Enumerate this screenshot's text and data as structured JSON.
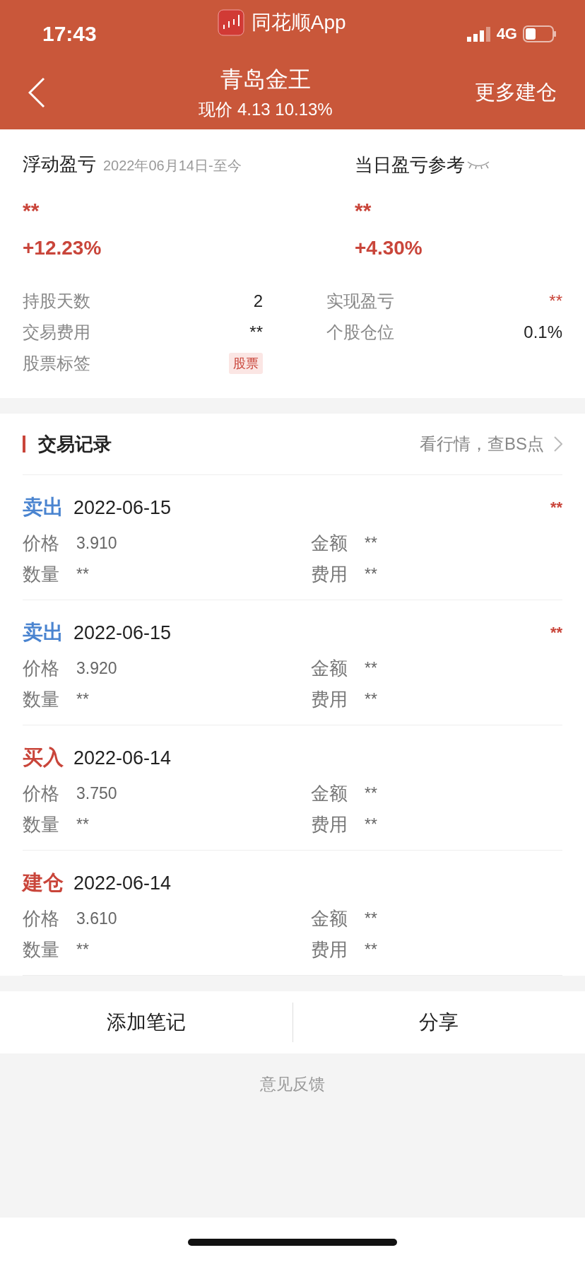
{
  "status_bar": {
    "time": "17:43",
    "app": "同花顺App",
    "network": "4G"
  },
  "nav": {
    "title": "青岛金王",
    "subtitle": "现价 4.13 10.13%",
    "action": "更多建仓"
  },
  "summary": {
    "floating": {
      "label": "浮动盈亏",
      "period": "2022年06月14日-至今",
      "value": "**",
      "percent": "+12.23%"
    },
    "daily": {
      "label": "当日盈亏参考",
      "value": "**",
      "percent": "+4.30%"
    },
    "stats": [
      {
        "label": "持股天数",
        "value": "2",
        "kind": "plain"
      },
      {
        "label": "实现盈亏",
        "value": "**",
        "kind": "profit"
      },
      {
        "label": "交易费用",
        "value": "**",
        "kind": "plain"
      },
      {
        "label": "个股仓位",
        "value": "0.1%",
        "kind": "plain"
      },
      {
        "label": "股票标签",
        "value": "股票",
        "kind": "tag"
      }
    ]
  },
  "trades": {
    "title": "交易记录",
    "link": "看行情，查BS点",
    "records": [
      {
        "type": "卖出",
        "kind": "sell",
        "date": "2022-06-15",
        "result": "**",
        "fields": [
          {
            "label": "价格",
            "value": "3.910"
          },
          {
            "label": "金额",
            "value": "**"
          },
          {
            "label": "数量",
            "value": "**"
          },
          {
            "label": "费用",
            "value": "**"
          }
        ]
      },
      {
        "type": "卖出",
        "kind": "sell",
        "date": "2022-06-15",
        "result": "**",
        "fields": [
          {
            "label": "价格",
            "value": "3.920"
          },
          {
            "label": "金额",
            "value": "**"
          },
          {
            "label": "数量",
            "value": "**"
          },
          {
            "label": "费用",
            "value": "**"
          }
        ]
      },
      {
        "type": "买入",
        "kind": "buy",
        "date": "2022-06-14",
        "fields": [
          {
            "label": "价格",
            "value": "3.750"
          },
          {
            "label": "金额",
            "value": "**"
          },
          {
            "label": "数量",
            "value": "**"
          },
          {
            "label": "费用",
            "value": "**"
          }
        ]
      },
      {
        "type": "建仓",
        "kind": "buy",
        "date": "2022-06-14",
        "fields": [
          {
            "label": "价格",
            "value": "3.610"
          },
          {
            "label": "金额",
            "value": "**"
          },
          {
            "label": "数量",
            "value": "**"
          },
          {
            "label": "费用",
            "value": "**"
          }
        ]
      }
    ]
  },
  "actions": [
    "添加笔记",
    "分享"
  ],
  "feedback": "意见反馈"
}
